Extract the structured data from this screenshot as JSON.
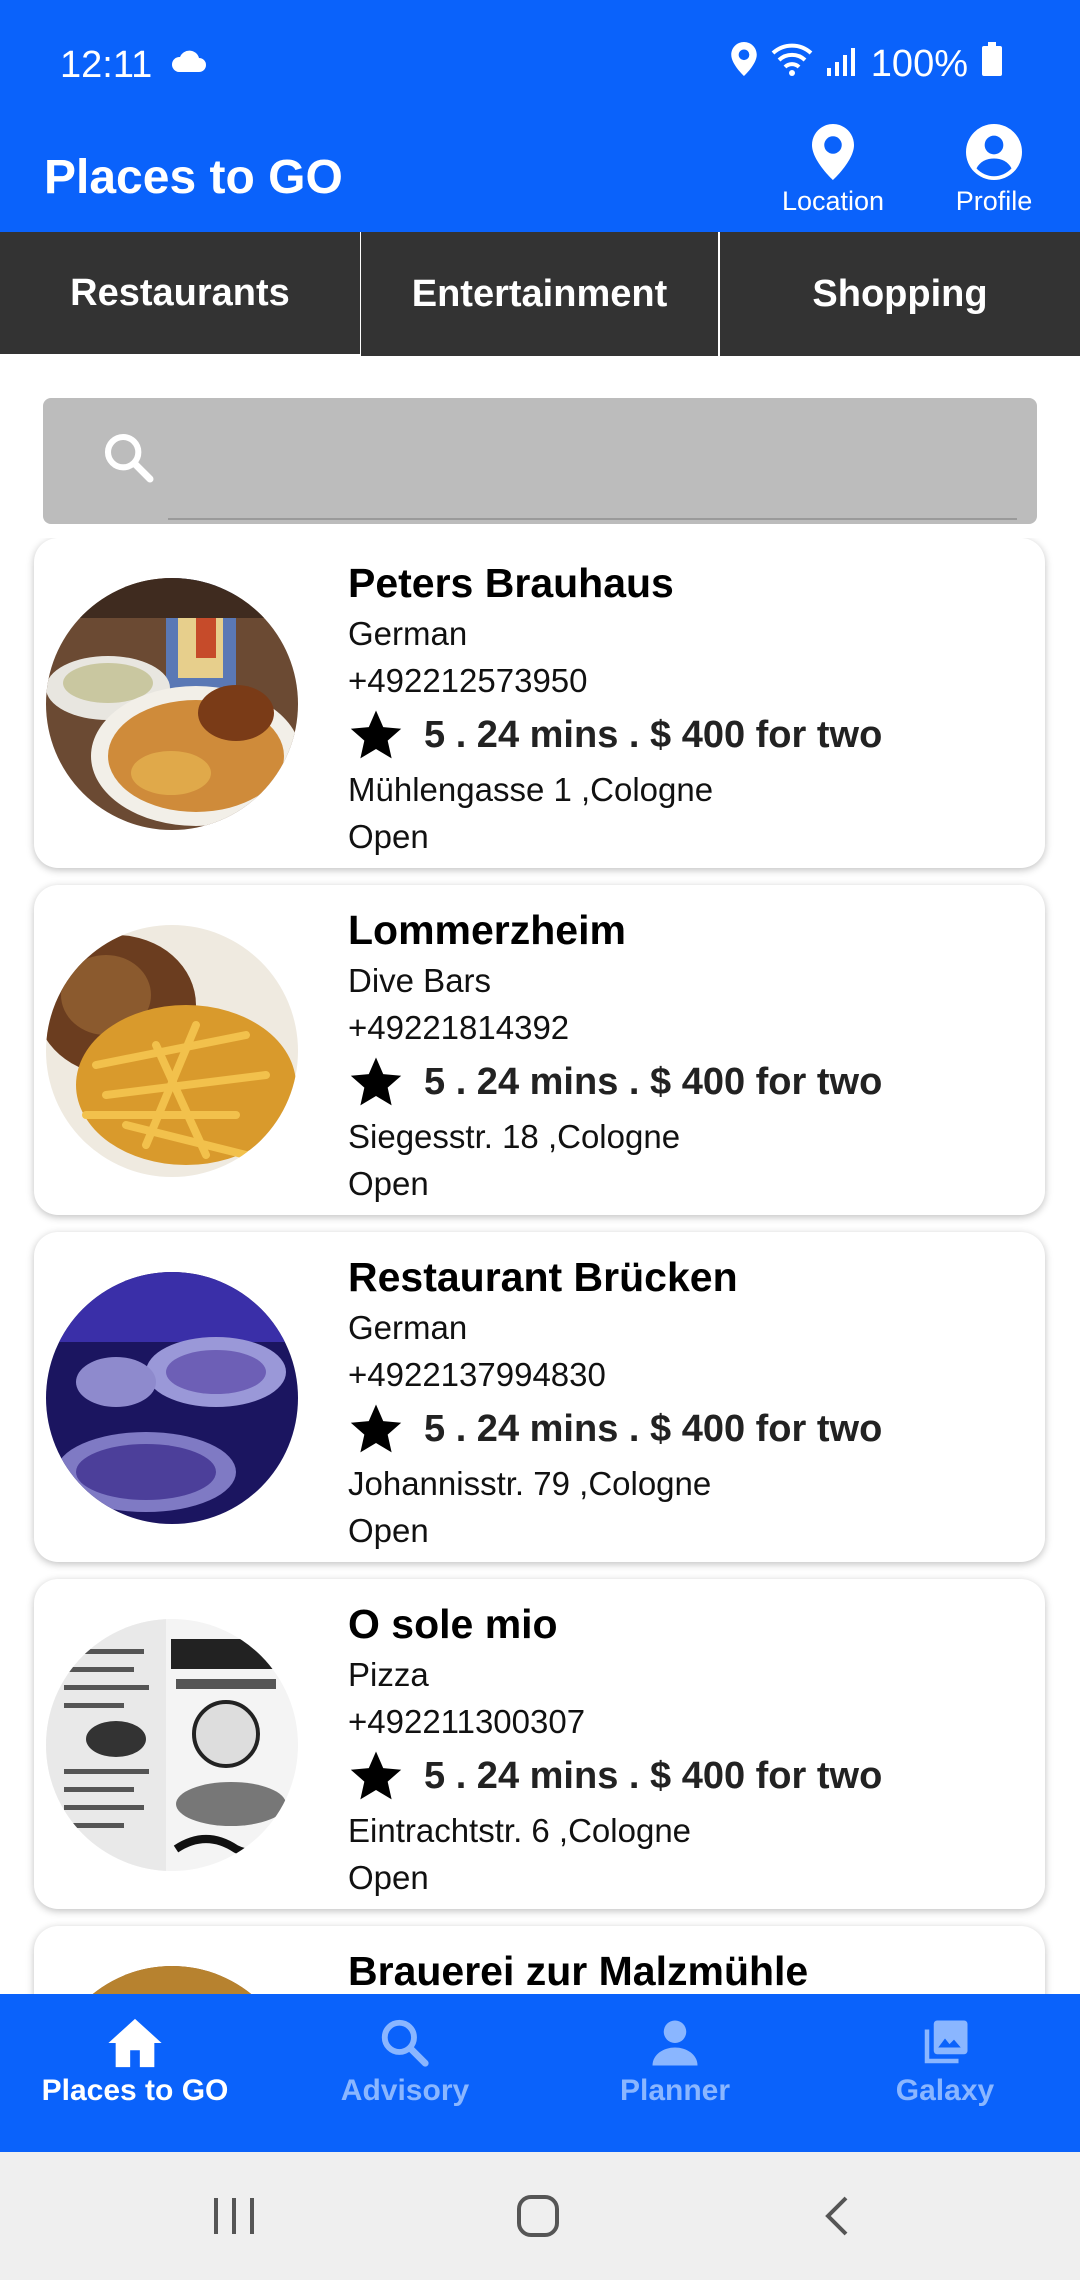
{
  "status_bar": {
    "time": "12:11",
    "battery": "100%"
  },
  "app_bar": {
    "title": "Places to GO",
    "actions": [
      {
        "label": "Location",
        "icon": "location-pin-icon"
      },
      {
        "label": "Profile",
        "icon": "account-circle-icon"
      }
    ]
  },
  "tabs": [
    {
      "label": "Restaurants",
      "active": true
    },
    {
      "label": "Entertainment",
      "active": false
    },
    {
      "label": "Shopping",
      "active": false
    }
  ],
  "search": {
    "placeholder": ""
  },
  "places": [
    {
      "name": "Peters Brauhaus",
      "category": "German",
      "phone": "+492212573950",
      "meta": "5 . 24 mins . $ 400 for two",
      "address": "Mühlengasse 1 ,Cologne",
      "status": "Open"
    },
    {
      "name": "Lommerzheim",
      "category": "Dive Bars",
      "phone": "+49221814392",
      "meta": "5 . 24 mins . $ 400 for two",
      "address": "Siegesstr. 18 ,Cologne",
      "status": "Open"
    },
    {
      "name": "Restaurant Brücken",
      "category": "German",
      "phone": "+4922137994830",
      "meta": "5 . 24 mins . $ 400 for two",
      "address": "Johannisstr. 79 ,Cologne",
      "status": "Open"
    },
    {
      "name": "O sole mio",
      "category": "Pizza",
      "phone": "+492211300307",
      "meta": "5 . 24 mins . $ 400 for two",
      "address": "Eintrachtstr. 6 ,Cologne",
      "status": "Open"
    },
    {
      "name": "Brauerei zur Malzmühle",
      "category": "",
      "phone": "",
      "meta": "",
      "address": "",
      "status": ""
    }
  ],
  "bottom_nav": [
    {
      "label": "Places to GO",
      "icon": "home-icon",
      "active": true
    },
    {
      "label": "Advisory",
      "icon": "search-icon",
      "active": false
    },
    {
      "label": "Planner",
      "icon": "person-icon",
      "active": false
    },
    {
      "label": "Galaxy",
      "icon": "photo-library-icon",
      "active": false
    }
  ],
  "colors": {
    "primary": "#0a62fb",
    "tab_background": "#333333",
    "search_background": "#bcbcbc"
  }
}
